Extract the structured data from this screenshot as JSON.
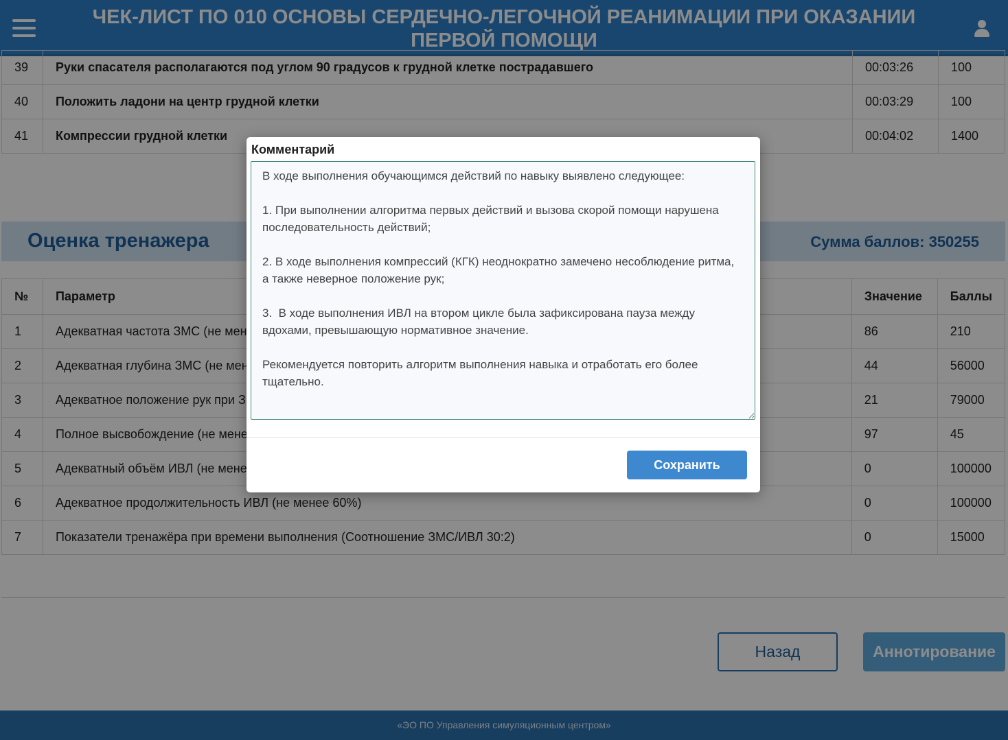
{
  "header": {
    "title": "ЧЕК-ЛИСТ ПО 010 ОСНОВЫ СЕРДЕЧНО-ЛЕГОЧНОЙ РЕАНИМАЦИИ ПРИ ОКАЗАНИИ ПЕРВОЙ ПОМОЩИ",
    "menu_icon": "hamburger-icon",
    "user_icon": "user-icon"
  },
  "checklist": {
    "rows": [
      {
        "num": "39",
        "name": "Руки спасателя располагаются под углом 90 градусов к грудной клетке пострадавшего",
        "time": "00:03:26",
        "score": "100"
      },
      {
        "num": "40",
        "name": "Положить ладони на центр грудной клетки",
        "time": "00:03:29",
        "score": "100"
      },
      {
        "num": "41",
        "name": "Компрессии грудной клетки",
        "time": "00:04:02",
        "score": "1400"
      }
    ]
  },
  "trainer": {
    "title": "Оценка тренажера",
    "score_label": "Сумма баллов:",
    "score_value": "350255",
    "headers": {
      "num": "№",
      "param": "Параметр",
      "value": "Значение",
      "points": "Баллы"
    },
    "rows": [
      {
        "num": "1",
        "param": "Адекватная частота ЗМС (не менее",
        "value": "86",
        "points": "210"
      },
      {
        "num": "2",
        "param": "Адекватная глубина ЗМС (не менее",
        "value": "44",
        "points": "56000"
      },
      {
        "num": "3",
        "param": "Адекватное положение рук при ЗМС",
        "value": "21",
        "points": "79000"
      },
      {
        "num": "4",
        "param": "Полное высвобождение (не менее",
        "value": "97",
        "points": "45"
      },
      {
        "num": "5",
        "param": "Адекватный объём ИВЛ (не менее",
        "value": "0",
        "points": "100000"
      },
      {
        "num": "6",
        "param": "Адекватное продолжительность ИВЛ (не менее 60%)",
        "value": "0",
        "points": "100000"
      },
      {
        "num": "7",
        "param": "Показатели тренажёра при времени выполнения (Соотношение ЗМС/ИВЛ 30:2)",
        "value": "0",
        "points": "15000"
      }
    ]
  },
  "actions": {
    "back_label": "Назад",
    "annotate_label": "Аннотирование"
  },
  "footer": {
    "text": "«ЭО ПО Управления симуляционным центром»"
  },
  "modal": {
    "label": "Комментарий",
    "comment": "В ходе выполнения обучающимся действий по навыку выявлено следующее:\n\n1. При выполнении алгоритма первых действий и вызова скорой помощи нарушена последовательность действий;\n\n2. В ходе выполнения компрессий (КГК) неоднократно замечено несоблюдение ритма, а также неверное положение рук;\n\n3.  В ходе выполнения ИВЛ на втором цикле была зафиксирована пауза между вдохами, превышающую нормативное значение.\n\nРекомендуется повторить алгоритм выполнения навыка и отработать его более тщательно.",
    "save_label": "Сохранить"
  },
  "colors": {
    "header_bg": "#2f80c9",
    "section_bg": "#cfe2f3",
    "accent": "#1f5d97",
    "save_button": "#3d88cf"
  }
}
